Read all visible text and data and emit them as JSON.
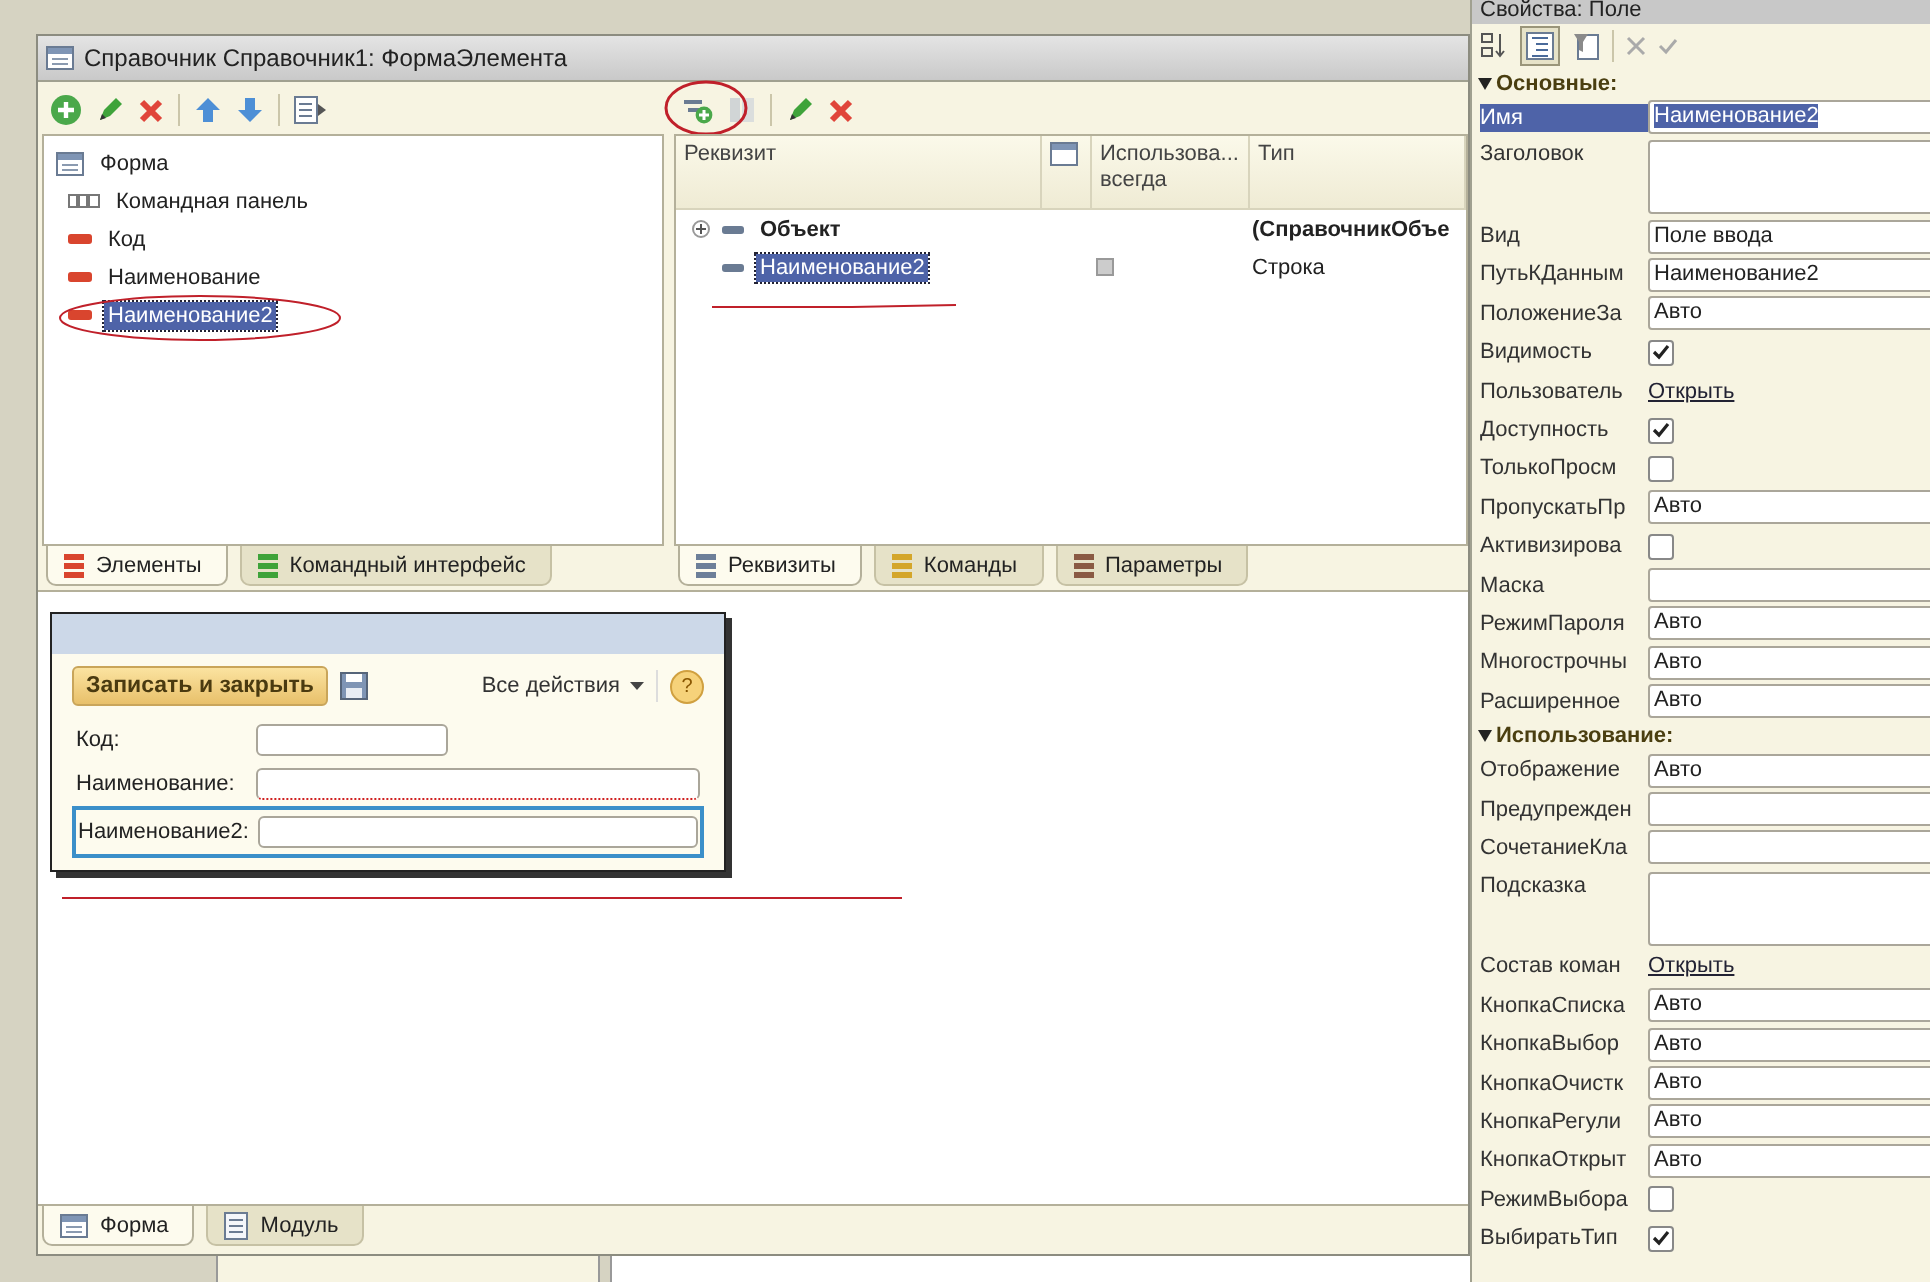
{
  "window": {
    "title": "Справочник Справочник1: ФормаЭлемента"
  },
  "tree": [
    {
      "label": "Форма",
      "kind": "form",
      "selected": false,
      "children": [
        {
          "label": "Командная панель",
          "kind": "command_panel",
          "selected": false
        },
        {
          "label": "Код",
          "kind": "field",
          "selected": false
        },
        {
          "label": "Наименование",
          "kind": "field",
          "selected": false
        },
        {
          "label": "Наименование2",
          "kind": "field",
          "selected": true
        }
      ]
    }
  ],
  "left_tabs": [
    {
      "label": "Элементы",
      "selected": true,
      "color": "#d9452e"
    },
    {
      "label": "Командный интерфейс",
      "selected": false,
      "color": "#3fa33a"
    }
  ],
  "attributes": {
    "columns": [
      {
        "kind": "text",
        "lines": [
          "Реквизит"
        ]
      },
      {
        "kind": "icon"
      },
      {
        "kind": "text",
        "lines": [
          "Использова...",
          "всегда"
        ]
      },
      {
        "kind": "text",
        "lines": [
          "Тип"
        ]
      }
    ],
    "rows": [
      {
        "name": "Объект",
        "kind": "main",
        "expanded": false,
        "selected": false,
        "type": "(СправочникОбъе"
      },
      {
        "name": "Наименование2",
        "kind": "attribute",
        "use_always": false,
        "selected": true,
        "type": "Строка"
      }
    ]
  },
  "right_tabs": [
    {
      "label": "Реквизиты",
      "selected": true,
      "color": "#6d7f99"
    },
    {
      "label": "Команды",
      "selected": false,
      "color": "#d4a62a"
    },
    {
      "label": "Параметры",
      "selected": false,
      "color": "#8a5a44"
    }
  ],
  "preview": {
    "save_button": "Записать и закрыть",
    "all_actions": "Все действия",
    "help": "?",
    "fields": [
      {
        "label": "Код:",
        "kind": "short",
        "required": false,
        "focused": false
      },
      {
        "label": "Наименование:",
        "kind": "long",
        "required": true,
        "focused": false
      },
      {
        "label": "Наименование2:",
        "kind": "long",
        "required": false,
        "focused": true
      }
    ]
  },
  "bottom_tabs": [
    {
      "label": "Форма",
      "kind": "form",
      "selected": true
    },
    {
      "label": "Модуль",
      "kind": "module",
      "selected": false
    }
  ],
  "properties": {
    "title": "Свойства: Поле",
    "groups": [
      {
        "label": "Основные:",
        "expanded": true,
        "rows": [
          {
            "name": "Имя",
            "kind": "field",
            "value": "Наименование2",
            "selected": true
          },
          {
            "name": "Заголовок",
            "kind": "textarea",
            "selected": false
          },
          {
            "name": "Вид",
            "kind": "field",
            "value": "Поле ввода",
            "selected": false
          },
          {
            "name": "ПутьКДанным",
            "kind": "field",
            "value": "Наименование2",
            "selected": false
          },
          {
            "name": "ПоложениеЗа",
            "kind": "field",
            "value": "Авто",
            "selected": false
          },
          {
            "name": "Видимость",
            "kind": "checkbox",
            "checked": true,
            "selected": false
          },
          {
            "name": "Пользователь",
            "kind": "link",
            "value": "Открыть",
            "selected": false
          },
          {
            "name": "Доступность",
            "kind": "checkbox",
            "checked": true,
            "selected": false
          },
          {
            "name": "ТолькоПросм",
            "kind": "checkbox",
            "checked": false,
            "selected": false
          },
          {
            "name": "ПропускатьПр",
            "kind": "field",
            "value": "Авто",
            "selected": false
          },
          {
            "name": "Активизирова",
            "kind": "checkbox",
            "checked": false,
            "selected": false
          },
          {
            "name": "Маска",
            "kind": "field",
            "selected": false
          },
          {
            "name": "РежимПароля",
            "kind": "field",
            "value": "Авто",
            "selected": false
          },
          {
            "name": "Многострочны",
            "kind": "field",
            "value": "Авто",
            "selected": false
          },
          {
            "name": "Расширенное",
            "kind": "field",
            "value": "Авто",
            "selected": false
          }
        ]
      },
      {
        "label": "Использование:",
        "expanded": true,
        "rows": [
          {
            "name": "Отображение",
            "kind": "field",
            "value": "Авто",
            "selected": false
          },
          {
            "name": "Предупрежден",
            "kind": "field",
            "selected": false
          },
          {
            "name": "СочетаниеКла",
            "kind": "field",
            "selected": false
          },
          {
            "name": "Подсказка",
            "kind": "textarea",
            "selected": false
          },
          {
            "name": "Состав коман",
            "kind": "link",
            "value": "Открыть",
            "selected": false
          },
          {
            "name": "КнопкаСписка",
            "kind": "field",
            "value": "Авто",
            "selected": false
          },
          {
            "name": "КнопкаВыбор",
            "kind": "field",
            "value": "Авто",
            "selected": false
          },
          {
            "name": "КнопкаОчистк",
            "kind": "field",
            "value": "Авто",
            "selected": false
          },
          {
            "name": "КнопкаРегули",
            "kind": "field",
            "value": "Авто",
            "selected": false
          },
          {
            "name": "КнопкаОткрыт",
            "kind": "field",
            "value": "Авто",
            "selected": false
          },
          {
            "name": "РежимВыбора",
            "kind": "checkbox",
            "checked": false,
            "selected": false
          },
          {
            "name": "ВыбиратьТип",
            "kind": "checkbox",
            "checked": true,
            "selected": false
          }
        ]
      }
    ]
  }
}
